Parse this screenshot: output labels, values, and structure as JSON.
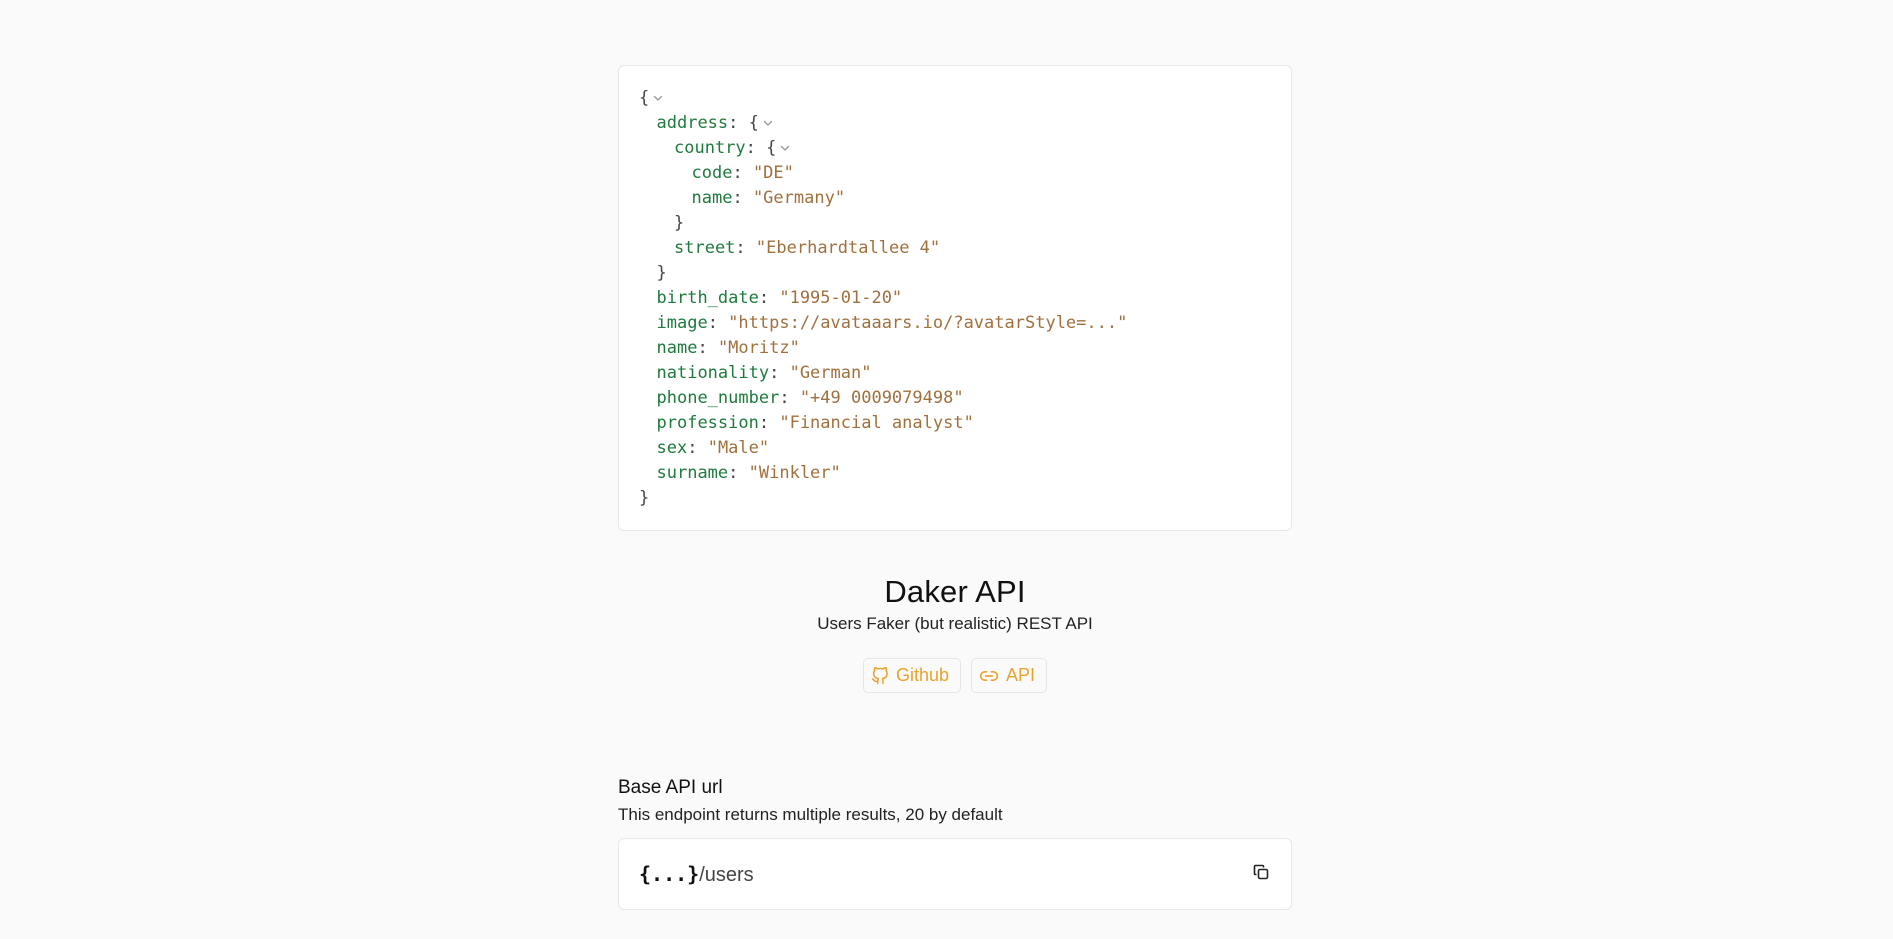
{
  "json_viewer": {
    "lines": [
      {
        "indent": 0,
        "key": "",
        "value": "",
        "open": "{",
        "close": "",
        "collapsible": true
      },
      {
        "indent": 1,
        "key": "address",
        "value": "",
        "open": "{",
        "close": "",
        "collapsible": true
      },
      {
        "indent": 2,
        "key": "country",
        "value": "",
        "open": "{",
        "close": "",
        "collapsible": true
      },
      {
        "indent": 3,
        "key": "code",
        "value": "\"DE\"",
        "open": "",
        "close": "",
        "collapsible": false
      },
      {
        "indent": 3,
        "key": "name",
        "value": "\"Germany\"",
        "open": "",
        "close": "",
        "collapsible": false
      },
      {
        "indent": 2,
        "key": "",
        "value": "",
        "open": "",
        "close": "}",
        "collapsible": false
      },
      {
        "indent": 2,
        "key": "street",
        "value": "\"Eberhardtallee 4\"",
        "open": "",
        "close": "",
        "collapsible": false
      },
      {
        "indent": 1,
        "key": "",
        "value": "",
        "open": "",
        "close": "}",
        "collapsible": false
      },
      {
        "indent": 1,
        "key": "birth_date",
        "value": "\"1995-01-20\"",
        "open": "",
        "close": "",
        "collapsible": false
      },
      {
        "indent": 1,
        "key": "image",
        "value": "\"https://avataaars.io/?avatarStyle=...\"",
        "open": "",
        "close": "",
        "collapsible": false
      },
      {
        "indent": 1,
        "key": "name",
        "value": "\"Moritz\"",
        "open": "",
        "close": "",
        "collapsible": false
      },
      {
        "indent": 1,
        "key": "nationality",
        "value": "\"German\"",
        "open": "",
        "close": "",
        "collapsible": false
      },
      {
        "indent": 1,
        "key": "phone_number",
        "value": "\"+49 0009079498\"",
        "open": "",
        "close": "",
        "collapsible": false
      },
      {
        "indent": 1,
        "key": "profession",
        "value": "\"Financial analyst\"",
        "open": "",
        "close": "",
        "collapsible": false
      },
      {
        "indent": 1,
        "key": "sex",
        "value": "\"Male\"",
        "open": "",
        "close": "",
        "collapsible": false
      },
      {
        "indent": 1,
        "key": "surname",
        "value": "\"Winkler\"",
        "open": "",
        "close": "",
        "collapsible": false
      },
      {
        "indent": 0,
        "key": "",
        "value": "",
        "open": "",
        "close": "}",
        "collapsible": false
      }
    ],
    "key_color": "#1f7a3d",
    "string_color": "#a0703e",
    "chevron_icon": "chevron-down-icon"
  },
  "hero": {
    "title": "Daker API",
    "subtitle": "Users Faker (but realistic) REST API",
    "github_label": "Github",
    "github_icon": "github-icon",
    "api_label": "API",
    "api_icon": "link-icon",
    "accent_color": "#e8a32e"
  },
  "base_url_section": {
    "title": "Base API url",
    "description": "This endpoint returns multiple results, 20 by default",
    "url_base": "{...}",
    "url_path": "/users",
    "copy_icon": "copy-icon"
  }
}
